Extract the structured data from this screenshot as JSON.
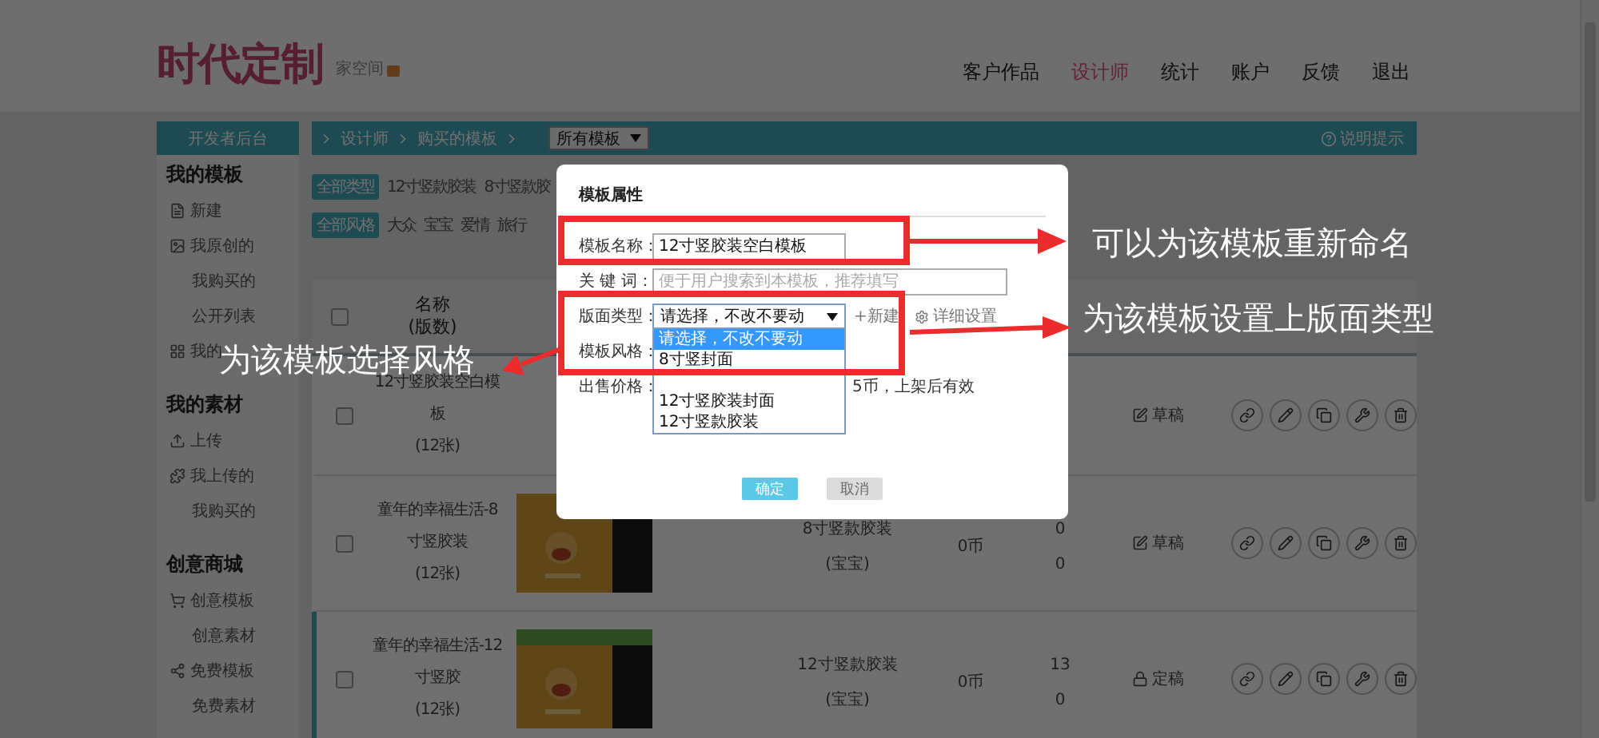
{
  "header": {
    "logo": "时代定制",
    "subtitle": "家空间",
    "nav": [
      {
        "label": "客户作品",
        "selected": false
      },
      {
        "label": "设计师",
        "selected": true
      },
      {
        "label": "统计",
        "selected": false
      },
      {
        "label": "账户",
        "selected": false
      },
      {
        "label": "反馈",
        "selected": false
      },
      {
        "label": "退出",
        "selected": false
      }
    ]
  },
  "sidebar": {
    "title": "开发者后台",
    "sections": [
      {
        "title": "我的模板",
        "items": [
          {
            "label": "新建",
            "kind": "main"
          },
          {
            "label": "我原创的",
            "kind": "main"
          },
          {
            "label": "我购买的",
            "kind": "sub"
          },
          {
            "label": "公开列表",
            "kind": "sub"
          },
          {
            "label": "我的",
            "kind": "main"
          }
        ]
      },
      {
        "title": "我的素材",
        "items": [
          {
            "label": "上传",
            "kind": "main"
          },
          {
            "label": "我上传的",
            "kind": "main"
          },
          {
            "label": "我购买的",
            "kind": "sub"
          }
        ]
      },
      {
        "title": "创意商城",
        "items": [
          {
            "label": "创意模板",
            "kind": "main"
          },
          {
            "label": "创意素材",
            "kind": "sub"
          },
          {
            "label": "免费模板",
            "kind": "main"
          },
          {
            "label": "免费素材",
            "kind": "sub"
          }
        ]
      }
    ]
  },
  "breadcrumb": {
    "items": [
      "设计师",
      "购买的模板"
    ],
    "select": "所有模板",
    "help": "说明提示"
  },
  "filters": [
    {
      "chips": [
        {
          "label": "全部类型",
          "selected": true
        },
        {
          "label": "12寸竖款胶装",
          "selected": false
        },
        {
          "label": "8寸竖款胶",
          "selected": false
        }
      ]
    },
    {
      "chips": [
        {
          "label": "全部风格",
          "selected": true
        },
        {
          "label": "大众",
          "selected": false
        },
        {
          "label": "宝宝",
          "selected": false
        },
        {
          "label": "爱情",
          "selected": false
        },
        {
          "label": "旅行",
          "selected": false
        }
      ]
    }
  ],
  "table": {
    "header": {
      "checked": false,
      "name": "名称",
      "name_sub": "(版数)"
    },
    "rows": [
      {
        "checked": false,
        "selected": false,
        "name": "12寸竖胶装空白模板",
        "pages": "(12张)",
        "status": {
          "label": "草稿",
          "kind": "draft"
        }
      },
      {
        "checked": false,
        "selected": false,
        "name": "童年的幸福生活-8寸竖胶装",
        "pages": "(12张)",
        "thumb": true,
        "type": "8寸竖款胶装",
        "style": "(宝宝)",
        "price": "0币",
        "count_1": "0",
        "count_2": "0",
        "status": {
          "label": "草稿",
          "kind": "draft"
        }
      },
      {
        "checked": false,
        "selected": true,
        "name": "童年的幸福生活-12寸竖胶",
        "pages": "(12张)",
        "thumb": true,
        "type": "12寸竖款胶装",
        "style": "(宝宝)",
        "price": "0币",
        "count_1": "13",
        "count_2": "0",
        "status": {
          "label": "定稿",
          "kind": "final"
        }
      }
    ]
  },
  "modal": {
    "title": "模板属性",
    "fields": [
      {
        "kind": "text",
        "label": "模板名称：",
        "value": "12寸竖胶装空白模板"
      },
      {
        "kind": "text",
        "label": "关 键 词：",
        "placeholder": "便于用户搜索到本模板，推荐填写"
      },
      {
        "kind": "select",
        "label": "版面类型：",
        "value": "请选择，不改不要动",
        "link": "+新建",
        "extra": "详细设置"
      },
      {
        "kind": "label",
        "label": "模板风格："
      },
      {
        "kind": "price",
        "label": "出售价格：",
        "suffix": "5币，上架后有效"
      }
    ],
    "dropdown": [
      {
        "label": "请选择，不改不要动",
        "selected": true
      },
      {
        "label": "8寸竖封面",
        "selected": false
      },
      {
        "label": "12寸竖胶装封面",
        "selected": false
      },
      {
        "label": "12寸竖款胶装",
        "selected": false
      }
    ],
    "buttons": [
      {
        "label": "确定",
        "kind": "primary"
      },
      {
        "label": "取消",
        "kind": "disabled"
      }
    ]
  },
  "annotations": [
    {
      "text": "可以为该模板重新命名"
    },
    {
      "text": "为该模板设置上版面类型"
    },
    {
      "text": "为该模板选择风格"
    }
  ]
}
